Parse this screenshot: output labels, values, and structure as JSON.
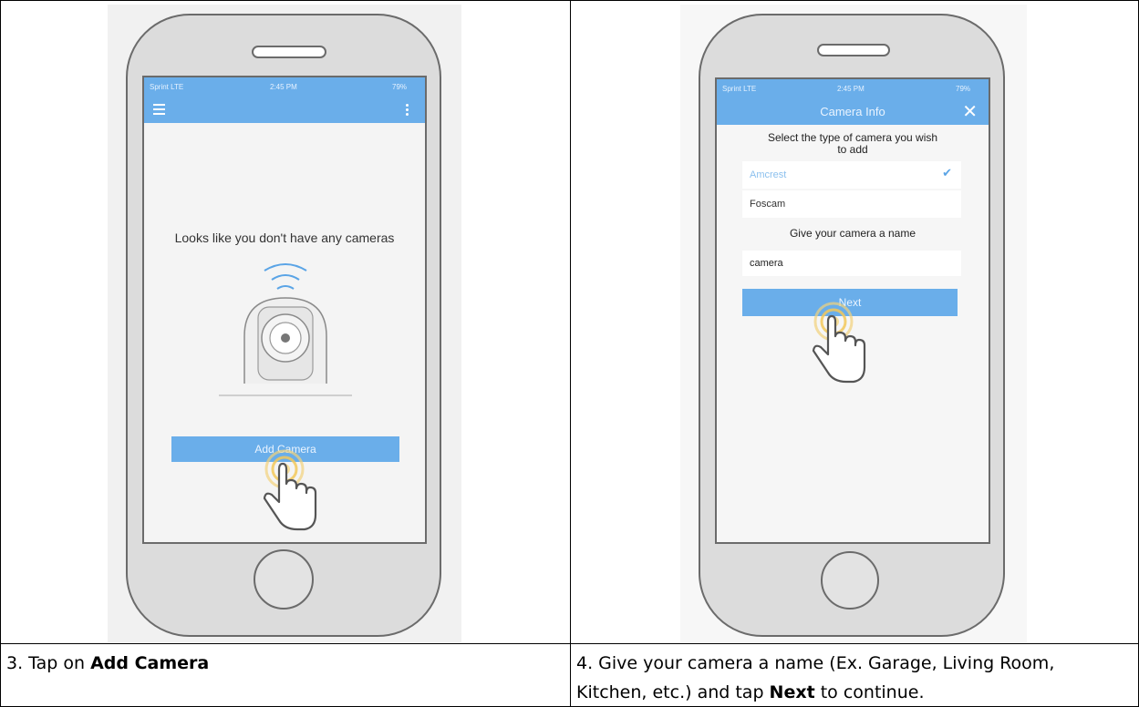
{
  "left_phone": {
    "status": {
      "carrier": "Sprint  LTE",
      "time": "2:45 PM",
      "battery": "79%"
    },
    "empty_message": "Looks like you don't have any cameras",
    "add_button": "Add Camera"
  },
  "right_phone": {
    "status": {
      "carrier": "Sprint  LTE",
      "time": "2:45 PM",
      "battery": "79%"
    },
    "title": "Camera Info",
    "select_prompt_line1": "Select the type of camera you wish",
    "select_prompt_line2": "to add",
    "options": [
      {
        "label": "Amcrest",
        "selected": true
      },
      {
        "label": "Foscam",
        "selected": false
      }
    ],
    "name_prompt": "Give your camera a name",
    "name_value": "camera",
    "next_button": "Next"
  },
  "captions": {
    "left_prefix": "3. Tap on ",
    "left_bold": "Add Camera",
    "right_line1": "4. Give your camera a name (Ex. Garage, Living Room,",
    "right_line2_prefix": "Kitchen, etc.) and tap ",
    "right_bold": "Next",
    "right_suffix": " to continue."
  },
  "colors": {
    "accent": "#6aaeea",
    "tap_ring": "#f2c85a"
  }
}
